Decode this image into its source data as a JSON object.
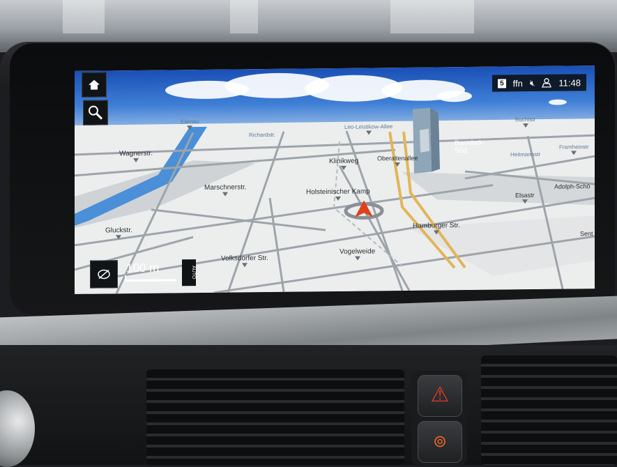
{
  "nav": {
    "status": {
      "preset_number": "5",
      "station": "ffn",
      "clock": "11:48"
    },
    "scale": {
      "distance": "100 m",
      "zoom_mode": "AUTO"
    },
    "streets": {
      "eilenau": "Eilenau",
      "richardstr": "Richardstr.",
      "leo_leistikow": "Leo-Leistikow-Allee",
      "buchtstr": "Buchtstr",
      "wagnerstr": "Wagnerstr.",
      "klinikweg": "Klinikweg",
      "oberaltenallee": "Oberaltenallee",
      "barmbek_sud": "Barmbek-\nSüd",
      "heitmannstr": "Heitmannstr",
      "framheinstr": "Framheinstr",
      "marschnerstr": "Marschnerstr.",
      "holsteinischer_kamp": "Holsteinischer Kamp",
      "adolph_schoenfelder": "Adolph-Schö",
      "elsastr": "Elsastr",
      "gluckstr": "Gluckstr.",
      "hamburger_str": "Hamburger Str.",
      "sent": "Sent",
      "volksdorfer_str": "Volksdorfer Str.",
      "vogelweide": "Vogelweide"
    },
    "icons": {
      "home": "home-icon",
      "search": "search-icon",
      "mute": "speaker-muted-icon",
      "profile": "profile-icon",
      "view": "view-toggle-icon",
      "position": "vehicle-position-icon"
    }
  },
  "colors": {
    "road_major": "#e2b558",
    "water": "#4a8fd8",
    "vehicle_arrow": "#e0401b",
    "map_bg": "#eceeee",
    "hazard": "#e63a22"
  }
}
